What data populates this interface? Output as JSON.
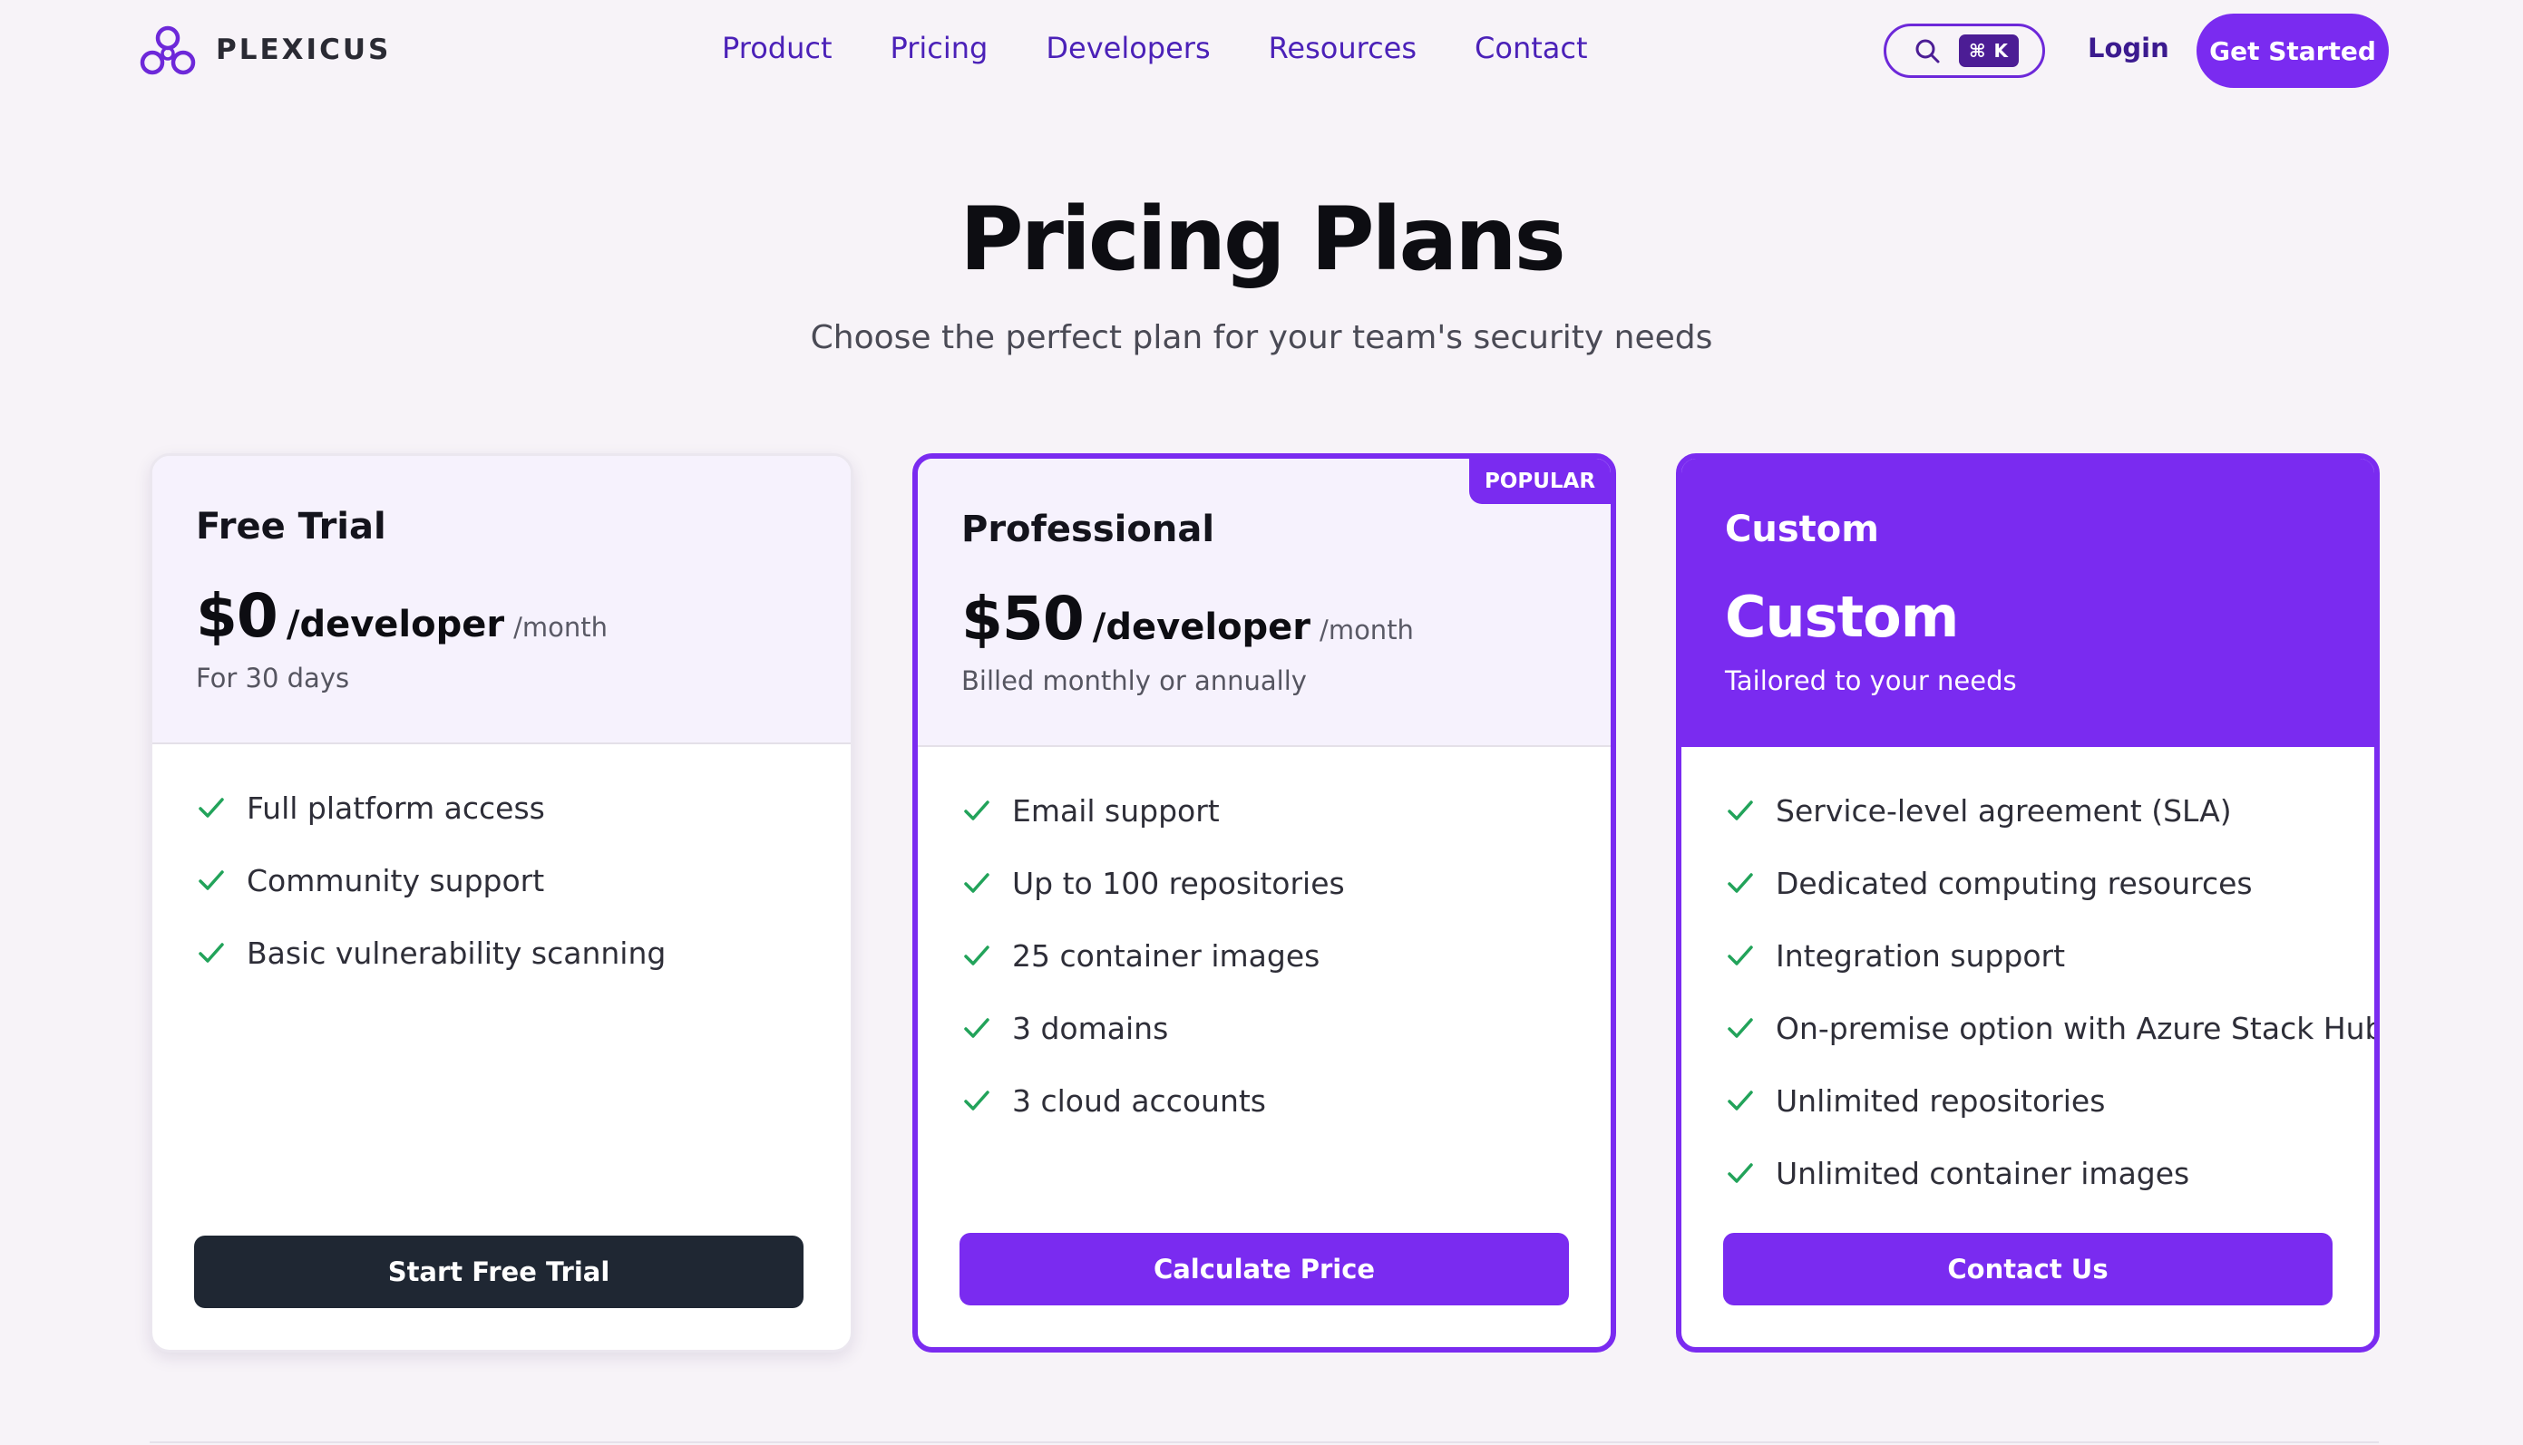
{
  "brand": {
    "name": "PLEXICUS",
    "accent": "#7a2bf0",
    "dark_button": "#1f2733",
    "check_color": "#22a35a"
  },
  "nav": {
    "links": [
      "Product",
      "Pricing",
      "Developers",
      "Resources",
      "Contact"
    ],
    "search_shortcut": "⌘ K",
    "login": "Login",
    "cta": "Get Started"
  },
  "hero": {
    "title": "Pricing Plans",
    "subtitle": "Choose the perfect plan for your team's security needs"
  },
  "plans": [
    {
      "name": "Free Trial",
      "price": "$0",
      "per": "/developer",
      "period": "/month",
      "note": "For 30 days",
      "features": [
        "Full platform access",
        "Community support",
        "Basic vulnerability scanning"
      ],
      "button": "Start Free Trial"
    },
    {
      "name": "Professional",
      "badge": "POPULAR",
      "price": "$50",
      "per": "/developer",
      "period": "/month",
      "note": "Billed monthly or annually",
      "features": [
        "Email support",
        "Up to 100 repositories",
        "25 container images",
        "3 domains",
        "3 cloud accounts"
      ],
      "button": "Calculate Price"
    },
    {
      "name": "Custom",
      "price": "Custom",
      "note": "Tailored to your needs",
      "features": [
        "Service-level agreement (SLA)",
        "Dedicated computing resources",
        "Integration support",
        "On-premise option with Azure Stack Hub",
        "Unlimited repositories",
        "Unlimited container images"
      ],
      "button": "Contact Us"
    }
  ]
}
